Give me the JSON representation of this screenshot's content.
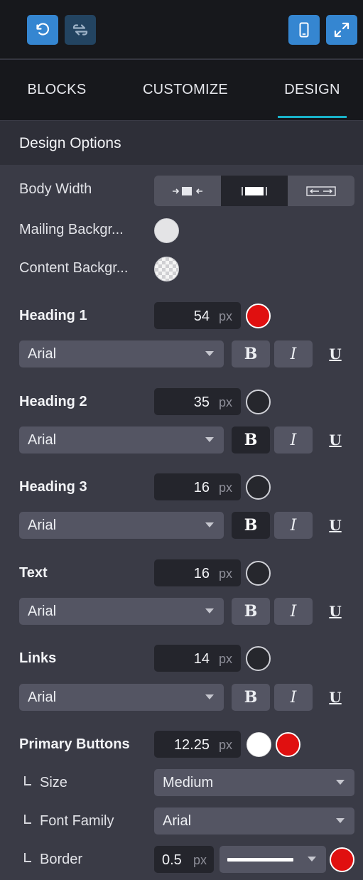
{
  "toolbar": {
    "undo_icon": "undo-icon",
    "swap_icon": "swap-icon",
    "mobile_icon": "mobile-icon",
    "expand_icon": "expand-icon"
  },
  "tabs": [
    {
      "label": "BLOCKS",
      "active": false
    },
    {
      "label": "CUSTOMIZE",
      "active": false
    },
    {
      "label": "DESIGN",
      "active": true
    }
  ],
  "section": {
    "title": "Design Options"
  },
  "body_width": {
    "label": "Body Width",
    "options": [
      "narrow",
      "medium",
      "wide"
    ],
    "selected": "medium"
  },
  "mailing_background": {
    "label": "Mailing Backgr...",
    "color": "#e4e4e6"
  },
  "content_background": {
    "label": "Content Backgr...",
    "color": "transparent"
  },
  "heading1": {
    "label": "Heading 1",
    "size": "54",
    "unit": "px",
    "color": "#e01010",
    "font": "Arial",
    "bold": false,
    "italic": false,
    "underline": false
  },
  "heading2": {
    "label": "Heading 2",
    "size": "35",
    "unit": "px",
    "color": "#26272d",
    "font": "Arial",
    "bold": true,
    "italic": false,
    "underline": false
  },
  "heading3": {
    "label": "Heading 3",
    "size": "16",
    "unit": "px",
    "color": "#26272d",
    "font": "Arial",
    "bold": true,
    "italic": false,
    "underline": false
  },
  "text": {
    "label": "Text",
    "size": "16",
    "unit": "px",
    "color": "#26272d",
    "font": "Arial",
    "bold": false,
    "italic": false,
    "underline": false
  },
  "links": {
    "label": "Links",
    "size": "14",
    "unit": "px",
    "color": "#26272d",
    "font": "Arial",
    "bold": false,
    "italic": false,
    "underline": true
  },
  "format": {
    "bold": "B",
    "italic": "I",
    "underline": "U"
  },
  "primary_buttons": {
    "label": "Primary Buttons",
    "size": "12.25",
    "unit": "px",
    "text_color": "#ffffff",
    "bg_color": "#e01010",
    "size_label": "Size",
    "size_value": "Medium",
    "font_family_label": "Font Family",
    "font_family_value": "Arial",
    "border_label": "Border",
    "border_width": "0.5",
    "border_unit": "px",
    "border_style": "solid",
    "border_color": "#e01010"
  }
}
